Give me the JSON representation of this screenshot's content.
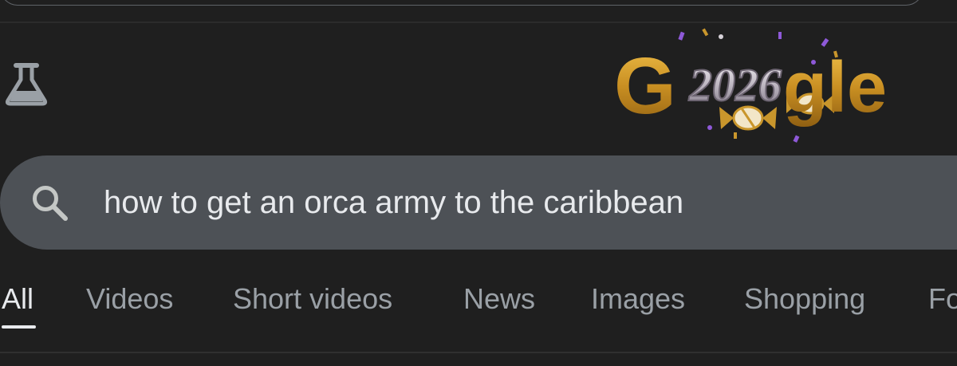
{
  "header": {
    "labs_icon": "flask-icon",
    "logo": {
      "year_text": "2026",
      "letters_left": "G",
      "letters_right": "gle",
      "colors": {
        "gold": "#c9962c",
        "silver": "#d7d2d9",
        "purple": "#8e59d8"
      }
    }
  },
  "search": {
    "icon": "search-icon",
    "query": "how to get an orca army to the caribbean"
  },
  "tabs": [
    {
      "label": "All",
      "active": true
    },
    {
      "label": "Videos",
      "active": false
    },
    {
      "label": "Short videos",
      "active": false
    },
    {
      "label": "News",
      "active": false
    },
    {
      "label": "Images",
      "active": false
    },
    {
      "label": "Shopping",
      "active": false
    },
    {
      "label": "Fo",
      "active": false
    }
  ],
  "theme": {
    "background": "#1f1f1f",
    "search_background": "#4d5156",
    "text_primary": "#e8eaed",
    "text_secondary": "#9aa0a6"
  }
}
